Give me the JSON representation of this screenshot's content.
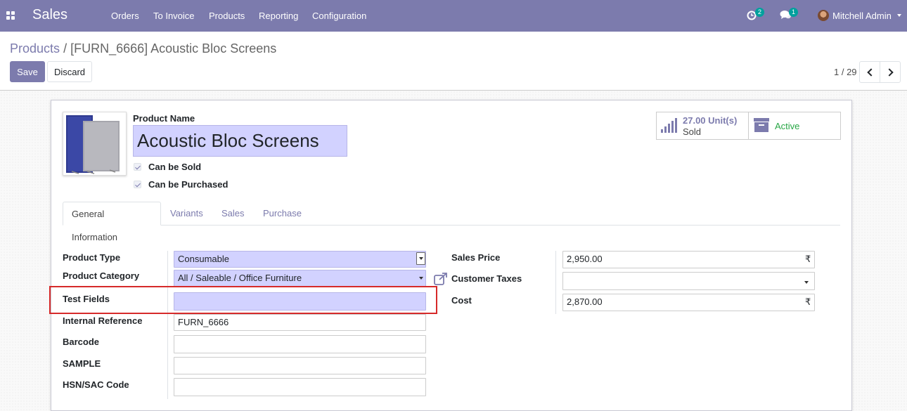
{
  "navbar": {
    "app_name": "Sales",
    "menu": [
      "Orders",
      "To Invoice",
      "Products",
      "Reporting",
      "Configuration"
    ],
    "activity_count": "2",
    "message_count": "1",
    "user_name": "Mitchell Admin",
    "accent_color": "#7c7bad"
  },
  "breadcrumb": {
    "parent": "Products",
    "separator": "/",
    "current": "[FURN_6666] Acoustic Bloc Screens"
  },
  "actions": {
    "save": "Save",
    "discard": "Discard"
  },
  "pager": {
    "value": "1 / 29"
  },
  "product": {
    "name_label": "Product Name",
    "name": "Acoustic Bloc Screens",
    "can_be_sold": "Can be Sold",
    "can_be_purchased": "Can be Purchased"
  },
  "smart_buttons": {
    "sold_value": "27.00 Unit(s)",
    "sold_label": "Sold",
    "active_label": "Active"
  },
  "tabs": [
    "General Information",
    "Variants",
    "Sales",
    "Purchase"
  ],
  "left_fields": {
    "product_type": {
      "label": "Product Type",
      "value": "Consumable"
    },
    "product_category": {
      "label": "Product Category",
      "value": "All / Saleable / Office Furniture"
    },
    "test_fields": {
      "label": "Test Fields",
      "value": ""
    },
    "internal_reference": {
      "label": "Internal Reference",
      "value": "FURN_6666"
    },
    "barcode": {
      "label": "Barcode",
      "value": ""
    },
    "sample": {
      "label": "SAMPLE",
      "value": ""
    },
    "hsn_sac_code": {
      "label": "HSN/SAC Code",
      "value": ""
    }
  },
  "right_fields": {
    "sales_price": {
      "label": "Sales Price",
      "value": "2,950.00",
      "currency": "₹"
    },
    "customer_taxes": {
      "label": "Customer Taxes",
      "value": ""
    },
    "cost": {
      "label": "Cost",
      "value": "2,870.00",
      "currency": "₹"
    }
  }
}
